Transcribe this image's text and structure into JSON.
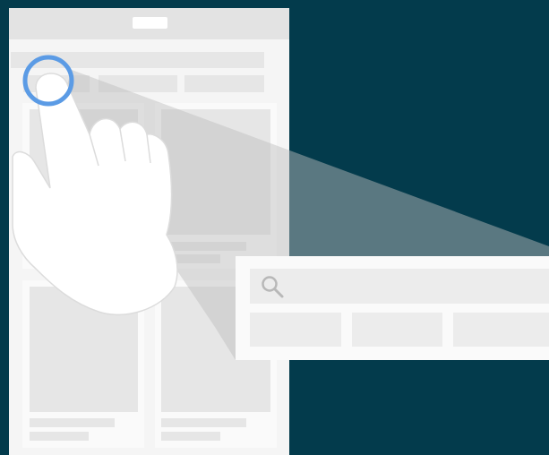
{
  "colors": {
    "background": "#033b4c",
    "phone_frame": "#f5f5f5",
    "phone_header": "#e3e3e3",
    "placeholder": "#e6e6e6",
    "card": "#fafafa",
    "popup": "#fafafa",
    "popup_field": "#ececec",
    "highlight_ring": "#5b9be5",
    "hand": "#ffffff",
    "hand_outline": "#dcdcdc",
    "search_icon": "#b8b8b8"
  },
  "icons": {
    "search": "search-icon",
    "tap_highlight": "tap-target-ring-icon",
    "hand": "hand-pointer-icon"
  },
  "phone": {
    "header_text": "",
    "card_count": 4
  },
  "popup": {
    "search_placeholder": "",
    "chip_count": 3
  }
}
